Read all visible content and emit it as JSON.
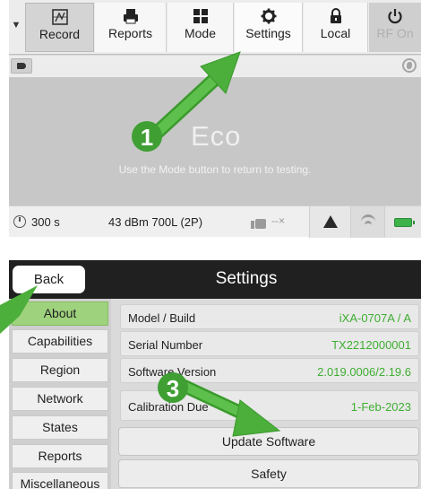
{
  "toolbar": {
    "buttons": [
      {
        "label": "Record",
        "icon": "record-icon"
      },
      {
        "label": "Reports",
        "icon": "printer-icon"
      },
      {
        "label": "Mode",
        "icon": "grid-icon"
      },
      {
        "label": "Settings",
        "icon": "gear-icon"
      },
      {
        "label": "Local",
        "icon": "lock-icon"
      },
      {
        "label": "RF On",
        "icon": "power-icon"
      }
    ]
  },
  "main": {
    "mode_title": "Eco",
    "hint": "Use the Mode button to return to testing."
  },
  "status_bar": {
    "timer": "300 s",
    "power": "43 dBm 700L (2P)",
    "signal": "--×"
  },
  "settings": {
    "back_label": "Back",
    "title": "Settings",
    "nav": [
      "About",
      "Capabilities",
      "Region",
      "Network",
      "States",
      "Reports",
      "Miscellaneous"
    ],
    "active_nav": "About",
    "info": [
      {
        "key": "Model / Build",
        "value": "iXA-0707A / A"
      },
      {
        "key": "Serial Number",
        "value": "TX2212000001"
      },
      {
        "key": "Software Version",
        "value": "2.019.0006/2.19.6"
      },
      {
        "key": "Calibration Due",
        "value": "1-Feb-2023"
      }
    ],
    "update_label": "Update Software",
    "safety_label": "Safety"
  },
  "annotations": {
    "step1": "1",
    "step3": "3"
  },
  "colors": {
    "accent_green": "#3fae32",
    "active_nav_green": "#9fd27d",
    "arrow_green": "#4cae3b",
    "header_dark": "#202020"
  }
}
